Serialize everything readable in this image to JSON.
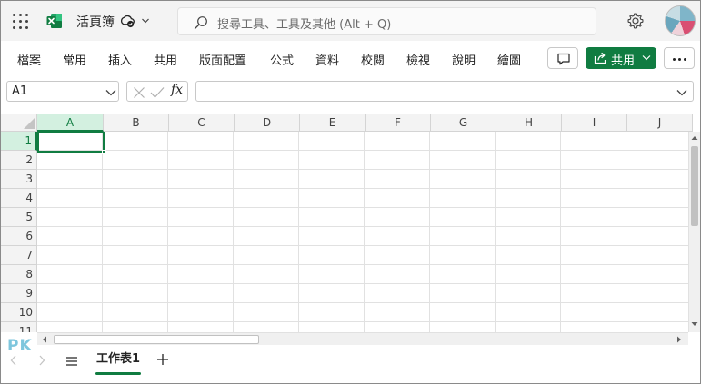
{
  "app": {
    "title": "活頁簿",
    "search_placeholder": "搜尋工具、工具及其他 (Alt + Q)",
    "brand_color": "#107c41"
  },
  "ribbon": {
    "tabs": [
      "檔案",
      "常用",
      "插入",
      "共用",
      "版面配置",
      "公式",
      "資料",
      "校閱",
      "檢視",
      "說明",
      "繪圖"
    ],
    "share_label": "共用"
  },
  "formula_bar": {
    "name_box": "A1",
    "fx_label": "fx",
    "formula": ""
  },
  "grid": {
    "columns": [
      "A",
      "B",
      "C",
      "D",
      "E",
      "F",
      "G",
      "H",
      "I",
      "J"
    ],
    "rows": [
      "1",
      "2",
      "3",
      "4",
      "5",
      "6",
      "7",
      "8",
      "9",
      "10",
      "11"
    ],
    "selected_column": "A",
    "selected_row": "1"
  },
  "sheets": {
    "tabs": [
      "工作表1"
    ],
    "active": "工作表1"
  },
  "watermark": "PK"
}
